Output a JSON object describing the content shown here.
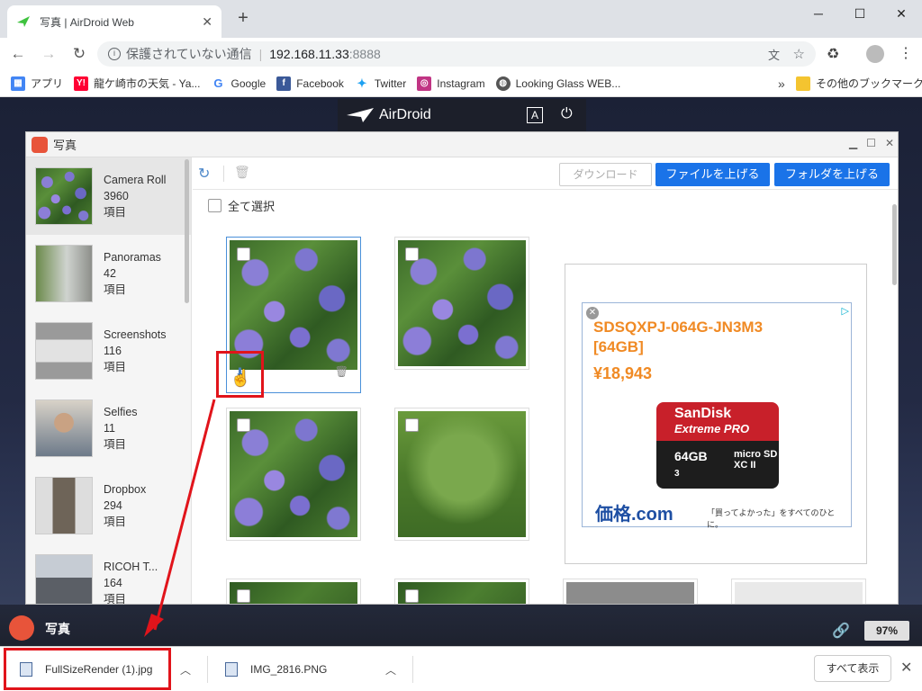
{
  "browser": {
    "tab_title": "写真 | AirDroid Web",
    "tab_close": "✕",
    "new_tab": "+",
    "url_security": "保護されていない通信",
    "url_host": "192.168.11.33",
    "url_port": ":8888",
    "bookmarks": [
      {
        "label": "アプリ",
        "icon": "apps-grid-icon",
        "color": "#4285f4"
      },
      {
        "label": "龍ケ崎市の天気 - Ya...",
        "icon": "yahoo-icon",
        "color": "#ff0033"
      },
      {
        "label": "Google",
        "icon": "google-icon",
        "color": "#4285f4"
      },
      {
        "label": "Facebook",
        "icon": "facebook-icon",
        "color": "#3b5998"
      },
      {
        "label": "Twitter",
        "icon": "twitter-icon",
        "color": "#1da1f2"
      },
      {
        "label": "Instagram",
        "icon": "instagram-icon",
        "color": "#c13584"
      },
      {
        "label": "Looking Glass WEB...",
        "icon": "globe-icon",
        "color": "#555555"
      }
    ],
    "bookmarks_more": "»",
    "other_bookmarks": "その他のブックマーク"
  },
  "airdroid": {
    "logo_text": "AirDroid",
    "font_btn": "A",
    "window_title": "写真",
    "albums": [
      {
        "name": "Camera Roll",
        "count": "3960",
        "unit": "項目",
        "thumb": "hyd",
        "active": true
      },
      {
        "name": "Panoramas",
        "count": "42",
        "unit": "項目",
        "thumb": "pano"
      },
      {
        "name": "Screenshots",
        "count": "116",
        "unit": "項目",
        "thumb": "shot"
      },
      {
        "name": "Selfies",
        "count": "11",
        "unit": "項目",
        "thumb": "selfie"
      },
      {
        "name": "Dropbox",
        "count": "294",
        "unit": "項目",
        "thumb": "dropbox"
      },
      {
        "name": "RICOH T...",
        "count": "164",
        "unit": "項目",
        "thumb": "ricoh"
      }
    ],
    "toolbar": {
      "download": "ダウンロード",
      "upload_file": "ファイルを上げる",
      "upload_folder": "フォルダを上げる"
    },
    "select_all": "全て選択",
    "ad": {
      "product": "SDSQXPJ-064G-JN3M3 [64GB]",
      "price": "¥18,943",
      "card_brand": "SanDisk",
      "card_line": "Extreme PRO",
      "card_size": "64GB",
      "card_micro": "micro SD XC II",
      "card_class": "3",
      "site": "価格.com",
      "tagline": "「買ってよかった」をすべてのひとに。"
    },
    "taskbar_label": "写真",
    "battery": "97%"
  },
  "downloads": {
    "items": [
      {
        "name": "FullSizeRender (1).jpg"
      },
      {
        "name": "IMG_2816.PNG"
      }
    ],
    "show_all": "すべて表示"
  }
}
